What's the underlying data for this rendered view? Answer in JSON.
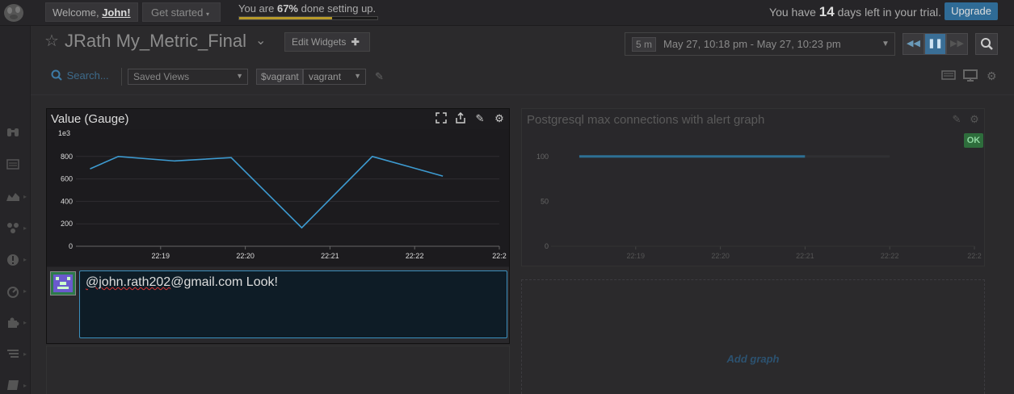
{
  "topbar": {
    "welcome_prefix": "Welcome,",
    "welcome_name": "John!",
    "get_started": "Get started",
    "setup_prefix": "You are",
    "setup_percent": "67%",
    "setup_suffix": "done setting up.",
    "setup_progress": 0.67,
    "trial_prefix": "You have",
    "trial_days": "14",
    "trial_suffix": "days left in your trial.",
    "upgrade": "Upgrade"
  },
  "header": {
    "title": "JRath My_Metric_Final",
    "edit_widgets": "Edit Widgets",
    "time_window": "5 m",
    "time_range": "May 27, 10:18 pm - May 27, 10:23 pm"
  },
  "filters": {
    "search_placeholder": "Search...",
    "saved_views": "Saved Views",
    "var_name": "$vagrant",
    "var_value": "vagrant"
  },
  "widget_gauge": {
    "title": "Value (Gauge)",
    "chart_data": {
      "type": "line",
      "y_unit": "1e3",
      "y_ticks": [
        "800",
        "600",
        "400",
        "200",
        "0"
      ],
      "x_ticks": [
        "22:19",
        "22:20",
        "22:21",
        "22:22",
        "22:2"
      ],
      "ylim": [
        0,
        1000
      ],
      "x": [
        "22:18:10",
        "22:18:30",
        "22:19:10",
        "22:19:50",
        "22:20:40",
        "22:21:30",
        "22:22:20"
      ],
      "values": [
        690,
        800,
        760,
        790,
        165,
        800,
        625
      ],
      "color": "#3d9bd1"
    }
  },
  "comment": {
    "mention": "@john.rath202",
    "rest": "@gmail.com Look!"
  },
  "widget_postgres": {
    "title": "Postgresql max connections with alert graph",
    "status": "OK",
    "chart_data": {
      "type": "line",
      "y_ticks": [
        "100",
        "50",
        "0"
      ],
      "x_ticks": [
        "22:19",
        "22:20",
        "22:21",
        "22:22",
        "22:2"
      ],
      "ylim": [
        0,
        125
      ],
      "series": [
        {
          "values": [
            100,
            100,
            100
          ]
        }
      ],
      "color": "#2d6f93"
    }
  },
  "add_graph": "Add graph",
  "colors": {
    "accent": "#2f6b96",
    "progress": "#b79a2a",
    "ok": "#2e6d3c"
  }
}
